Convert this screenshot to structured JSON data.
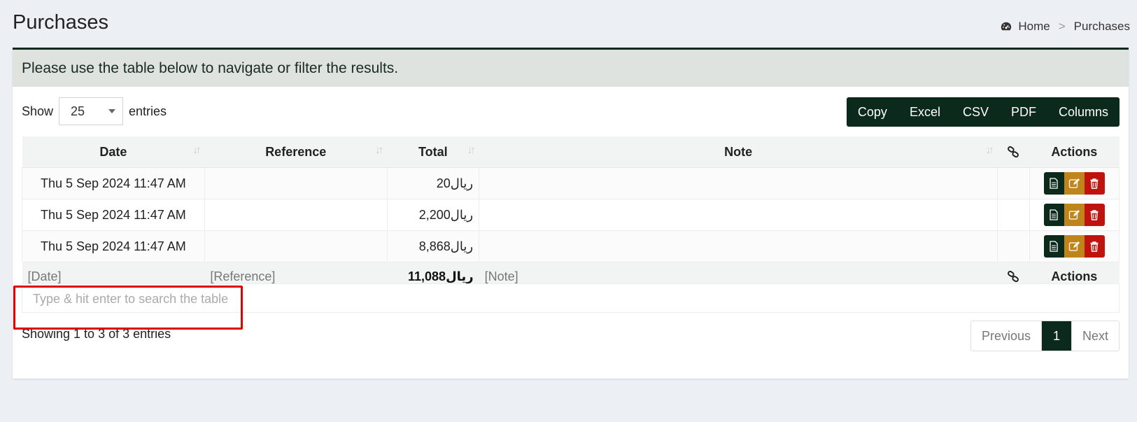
{
  "page": {
    "title": "Purchases"
  },
  "breadcrumb": {
    "home": "Home",
    "separator": ">",
    "current": "Purchases"
  },
  "panel": {
    "header": "Please use the table below to navigate or filter the results."
  },
  "length_menu": {
    "show_label": "Show",
    "value": "25",
    "entries_label": "entries"
  },
  "export_buttons": [
    "Copy",
    "Excel",
    "CSV",
    "PDF",
    "Columns"
  ],
  "table": {
    "columns": [
      "Date",
      "Reference",
      "Total",
      "Note",
      "",
      "Actions"
    ],
    "rows": [
      {
        "date": "Thu 5 Sep 2024 11:47 AM",
        "reference": "",
        "total": "ريال20",
        "note": ""
      },
      {
        "date": "Thu 5 Sep 2024 11:47 AM",
        "reference": "",
        "total": "ريال2,200",
        "note": ""
      },
      {
        "date": "Thu 5 Sep 2024 11:47 AM",
        "reference": "",
        "total": "ريال8,868",
        "note": ""
      }
    ],
    "footer": {
      "date": "[Date]",
      "reference": "[Reference]",
      "total": "ريال11,088",
      "note": "[Note]",
      "actions": "Actions"
    }
  },
  "search": {
    "placeholder": "Type & hit enter to search the table"
  },
  "info": "Showing 1 to 3 of 3 entries",
  "pagination": {
    "previous": "Previous",
    "current": "1",
    "next": "Next"
  },
  "colors": {
    "primary": "#0b2a1c",
    "edit": "#c0851a",
    "delete": "#c0130e",
    "highlight": "#e00000"
  }
}
